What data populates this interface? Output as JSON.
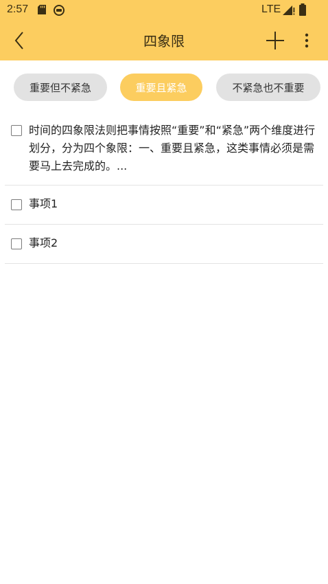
{
  "status_bar": {
    "time": "2:57",
    "network": "LTE",
    "icons": [
      "sd-card-icon",
      "camera-icon",
      "signal-icon",
      "battery-icon"
    ]
  },
  "app_bar": {
    "title": "四象限",
    "back_icon": "chevron-left-icon",
    "add_icon": "plus-icon",
    "more_icon": "more-vert-icon"
  },
  "filters": {
    "items": [
      {
        "label": "重要但不紧急",
        "active": false
      },
      {
        "label": "重要且紧急",
        "active": true
      },
      {
        "label": "不紧急也不重要",
        "active": false
      }
    ]
  },
  "tasks": [
    {
      "text": "时间的四象限法则把事情按照“重要”和“紧急”两个维度进行划分，分为四个象限：一、重要且紧急，这类事情必须是需要马上去完成的。...",
      "checked": false
    },
    {
      "text": "事项1",
      "checked": false
    },
    {
      "text": "事项2",
      "checked": false
    }
  ],
  "colors": {
    "accent": "#fccd5f",
    "chip_inactive": "#e2e2e2",
    "divider": "#e3e3e3",
    "text": "#222222"
  }
}
